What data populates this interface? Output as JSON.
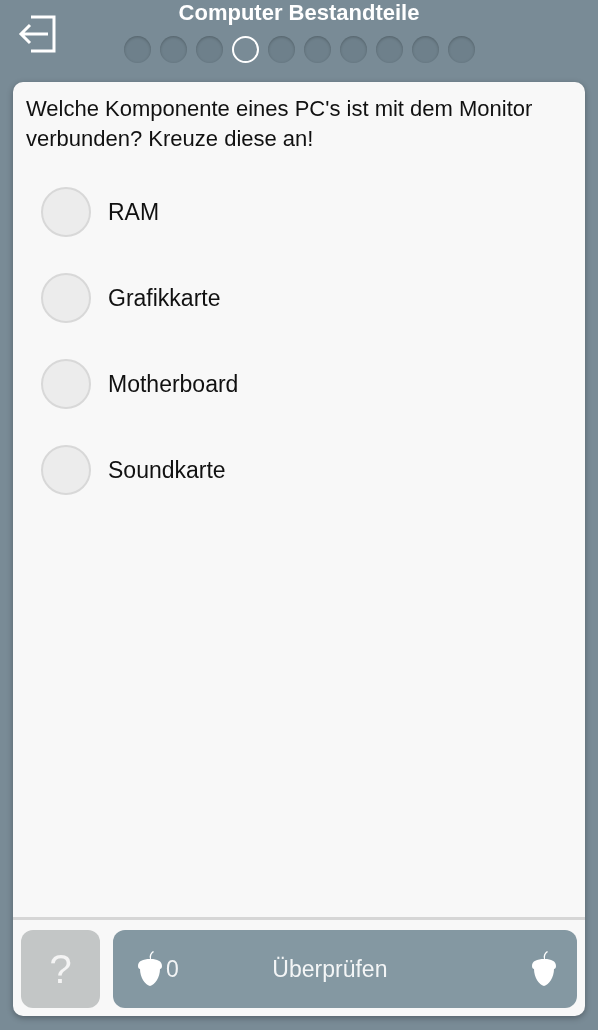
{
  "header": {
    "title": "Computer Bestandteile",
    "progress": [
      {
        "selected": false
      },
      {
        "selected": false
      },
      {
        "selected": false
      },
      {
        "selected": true
      },
      {
        "selected": false
      },
      {
        "selected": false
      },
      {
        "selected": false
      },
      {
        "selected": false
      },
      {
        "selected": false
      },
      {
        "selected": false
      }
    ]
  },
  "question": "Welche Komponente eines PC's ist mit dem Monitor verbunden? Kreuze diese an!",
  "options": [
    {
      "label": "RAM",
      "checked": false
    },
    {
      "label": "Grafikkarte",
      "checked": false
    },
    {
      "label": "Motherboard",
      "checked": false
    },
    {
      "label": "Soundkarte",
      "checked": false
    }
  ],
  "footer": {
    "help_label": "?",
    "acorn_count": "0",
    "check_label": "Überprüfen"
  }
}
